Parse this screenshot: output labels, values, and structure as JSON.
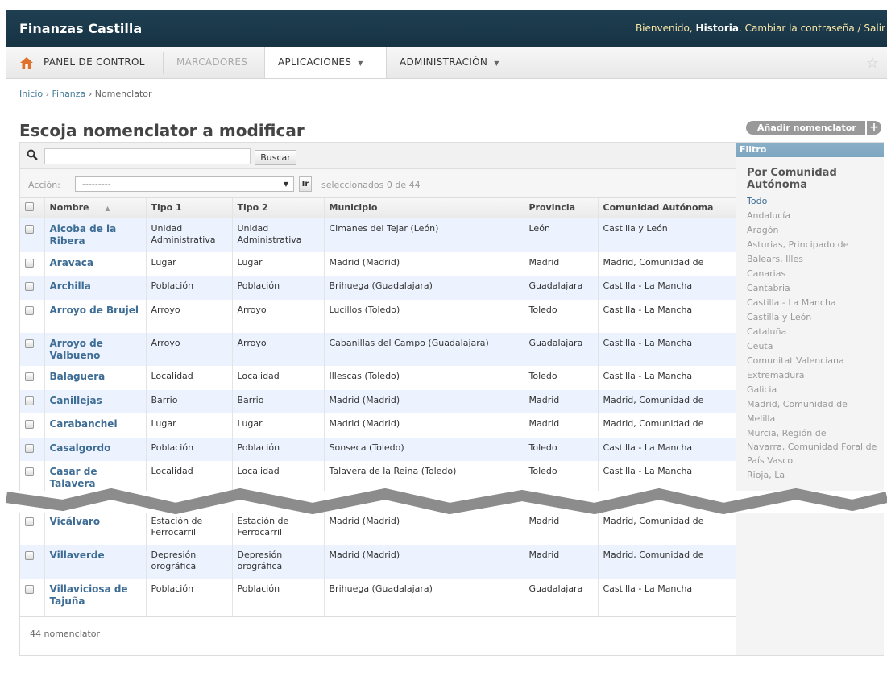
{
  "header": {
    "brand": "Finanzas Castilla",
    "welcome": "Bienvenido,",
    "user": "Historia",
    "change_password": "Cambiar la contraseña",
    "separator": "/",
    "logout": "Salir"
  },
  "menu": {
    "items": [
      {
        "label": "PANEL DE CONTROL"
      },
      {
        "label": "MARCADORES"
      },
      {
        "label": "APLICACIONES"
      },
      {
        "label": "ADMINISTRACIÓN"
      }
    ]
  },
  "breadcrumb": {
    "home": "Inicio",
    "app": "Finanza",
    "current": "Nomenclator",
    "sep": "›"
  },
  "page": {
    "title": "Escoja nomenclator a modificar",
    "add_button": "Añadir nomenclator",
    "add_plus": "+"
  },
  "search": {
    "value": "",
    "button": "Buscar"
  },
  "actions": {
    "label": "Acción:",
    "selected": "---------",
    "go": "Ir",
    "selected_count": "seleccionados 0 de 44"
  },
  "table": {
    "columns": [
      "Nombre",
      "Tipo 1",
      "Tipo 2",
      "Municipio",
      "Provincia",
      "Comunidad Autónoma"
    ],
    "rows": [
      {
        "nombre": "Alcoba de la Ribera",
        "tipo1": "Unidad Administrativa",
        "tipo2": "Unidad Administrativa",
        "municipio": "Cimanes del Tejar (León)",
        "provincia": "León",
        "comunidad": "Castilla y León"
      },
      {
        "nombre": "Aravaca",
        "tipo1": "Lugar",
        "tipo2": "Lugar",
        "municipio": "Madrid (Madrid)",
        "provincia": "Madrid",
        "comunidad": "Madrid, Comunidad de"
      },
      {
        "nombre": "Archilla",
        "tipo1": "Población",
        "tipo2": "Población",
        "municipio": "Brihuega (Guadalajara)",
        "provincia": "Guadalajara",
        "comunidad": "Castilla - La Mancha"
      },
      {
        "nombre": "Arroyo de Brujel",
        "tipo1": "Arroyo",
        "tipo2": "Arroyo",
        "municipio": "Lucillos (Toledo)",
        "provincia": "Toledo",
        "comunidad": "Castilla - La Mancha"
      },
      {
        "nombre": "Arroyo de Valbueno",
        "tipo1": "Arroyo",
        "tipo2": "Arroyo",
        "municipio": "Cabanillas del Campo (Guadalajara)",
        "provincia": "Guadalajara",
        "comunidad": "Castilla - La Mancha"
      },
      {
        "nombre": "Balaguera",
        "tipo1": "Localidad",
        "tipo2": "Localidad",
        "municipio": "Illescas (Toledo)",
        "provincia": "Toledo",
        "comunidad": "Castilla - La Mancha"
      },
      {
        "nombre": "Canillejas",
        "tipo1": "Barrio",
        "tipo2": "Barrio",
        "municipio": "Madrid (Madrid)",
        "provincia": "Madrid",
        "comunidad": "Madrid, Comunidad de"
      },
      {
        "nombre": "Carabanchel",
        "tipo1": "Lugar",
        "tipo2": "Lugar",
        "municipio": "Madrid (Madrid)",
        "provincia": "Madrid",
        "comunidad": "Madrid, Comunidad de"
      },
      {
        "nombre": "Casalgordo",
        "tipo1": "Población",
        "tipo2": "Población",
        "municipio": "Sonseca (Toledo)",
        "provincia": "Toledo",
        "comunidad": "Castilla - La Mancha"
      },
      {
        "nombre": "Casar de Talavera",
        "tipo1": "Localidad",
        "tipo2": "Localidad",
        "municipio": "Talavera de la Reina (Toledo)",
        "provincia": "Toledo",
        "comunidad": "Castilla - La Mancha"
      },
      {
        "nombre": "Vicálvaro",
        "tipo1": "Estación de Ferrocarril",
        "tipo2": "Estación de Ferrocarril",
        "municipio": "Madrid (Madrid)",
        "provincia": "Madrid",
        "comunidad": "Madrid, Comunidad de"
      },
      {
        "nombre": "Villaverde",
        "tipo1": "Depresión orográfica",
        "tipo2": "Depresión orográfica",
        "municipio": "Madrid (Madrid)",
        "provincia": "Madrid",
        "comunidad": "Madrid, Comunidad de"
      },
      {
        "nombre": "Villaviciosa de Tajuña",
        "tipo1": "Población",
        "tipo2": "Población",
        "municipio": "Brihuega (Guadalajara)",
        "provincia": "Guadalajara",
        "comunidad": "Castilla - La Mancha"
      }
    ],
    "footer": "44 nomenclator"
  },
  "filter": {
    "header": "Filtro",
    "title": "Por Comunidad Autónoma",
    "options": [
      "Todo",
      "Andalucía",
      "Aragón",
      "Asturias, Principado de",
      "Balears, Illes",
      "Canarias",
      "Cantabria",
      "Castilla - La Mancha",
      "Castilla y León",
      "Cataluña",
      "Ceuta",
      "Comunitat Valenciana",
      "Extremadura",
      "Galicia",
      "Madrid, Comunidad de",
      "Melilla",
      "Murcia, Región de",
      "Navarra, Comunidad Foral de",
      "País Vasco",
      "Rioja, La"
    ],
    "selected": "Todo"
  },
  "colors": {
    "header_bg": "#1f3f52",
    "link": "#3d6c95",
    "row_alt": "#edf3fe",
    "filter_head": "#7ea6c0"
  }
}
